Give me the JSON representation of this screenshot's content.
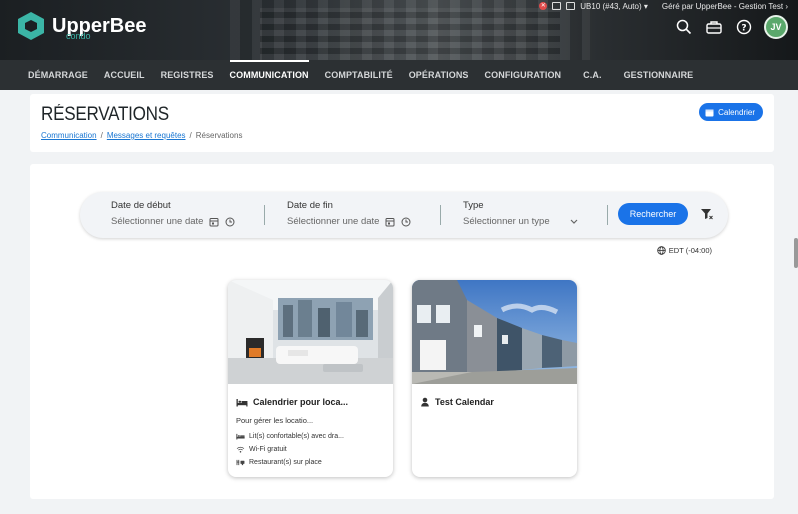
{
  "app": {
    "logo_text": "UpperBee",
    "logo_sub": "condo",
    "topline_building": "UB10 (#43, Auto) ▾",
    "topline_managed": "Géré par UpperBee - Gestion Test ›",
    "avatar_initials": "JV"
  },
  "nav": {
    "items": [
      {
        "label": "DÉMARRAGE"
      },
      {
        "label": "ACCUEIL"
      },
      {
        "label": "REGISTRES"
      },
      {
        "label": "COMMUNICATION"
      },
      {
        "label": "COMPTABILITÉ"
      },
      {
        "label": "OPÉRATIONS"
      },
      {
        "label": "CONFIGURATION"
      },
      {
        "label": "C.A."
      },
      {
        "label": "GESTIONNAIRE"
      }
    ],
    "active": "COMMUNICATION"
  },
  "page": {
    "title": "RÉSERVATIONS",
    "calendar_button": "Calendrier",
    "breadcrumb": {
      "item1": "Communication",
      "item2": "Messages et requêtes",
      "sep": "/",
      "current": "Réservations"
    }
  },
  "filters": {
    "start_label": "Date de début",
    "start_placeholder": "Sélectionner une date",
    "end_label": "Date de fin",
    "end_placeholder": "Sélectionner une date",
    "type_label": "Type",
    "type_placeholder": "Sélectionner un type",
    "search_button": "Rechercher",
    "timezone": "EDT (-04:00)"
  },
  "resources": [
    {
      "name": "Calendrier pour loca...",
      "description": "Pour gérer les locatio...",
      "features": [
        {
          "icon": "bed-icon",
          "label": "Lit(s) confortable(s) avec dra..."
        },
        {
          "icon": "wifi-icon",
          "label": "Wi-Fi gratuit"
        },
        {
          "icon": "restaurant-icon",
          "label": "Restaurant(s) sur place"
        }
      ]
    },
    {
      "name": "Test Calendar",
      "description": "",
      "features": []
    }
  ],
  "colors": {
    "primary": "#1a73e8",
    "brand": "#3bb5a6",
    "nav_bg": "#2c3033",
    "avatar": "#5aa86b"
  }
}
